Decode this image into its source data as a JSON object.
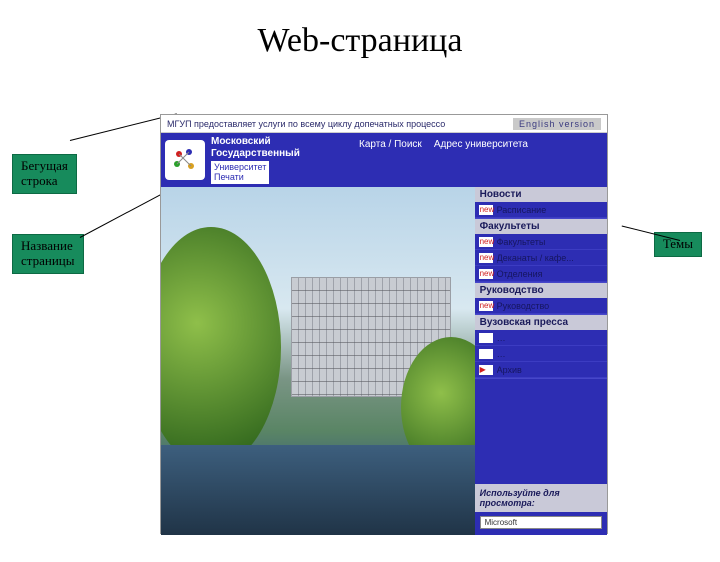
{
  "slide": {
    "title": "Web-страница"
  },
  "callouts": {
    "marquee": "Бегущая\nстрока",
    "pagename": "Название\nстраницы",
    "themes": "Темы"
  },
  "page": {
    "marquee_text": "МГУП предоставляет услуги по всему циклу допечатных процессо",
    "english_link": "English version",
    "logo": {
      "line1": "Московский",
      "line2": "Государственный",
      "line3": "Университет",
      "line4": "Печати"
    },
    "topnav": {
      "map_search": "Карта / Поиск",
      "address": "Адрес университета"
    },
    "sidenav": {
      "sections": [
        {
          "head": "Новости",
          "items": [
            {
              "label": "Расписание"
            }
          ]
        },
        {
          "head": "Факультеты",
          "items": [
            {
              "label": "Факультеты"
            },
            {
              "label": "Деканаты / кафе..."
            },
            {
              "label": "Отделения"
            }
          ]
        },
        {
          "head": "Руководство",
          "items": [
            {
              "label": "Руководство"
            }
          ]
        },
        {
          "head": "Вузовская пресса",
          "items": [
            {
              "label": "…"
            },
            {
              "label": "…"
            },
            {
              "label": "Архив"
            }
          ]
        }
      ],
      "viewer_hint": "Используйте для\nпросмотра:",
      "viewer_button": "Microsoft"
    }
  }
}
